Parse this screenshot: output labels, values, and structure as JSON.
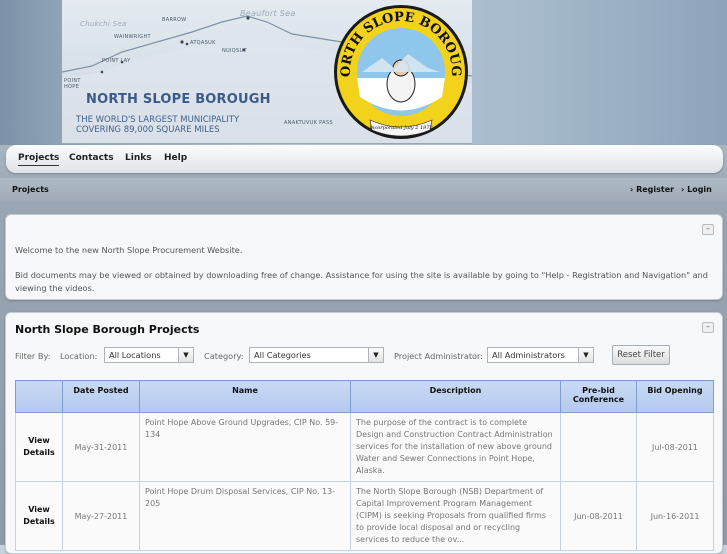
{
  "header": {
    "brand_title": "NORTH SLOPE BOROUGH",
    "brand_tagline_1": "THE WORLD'S LARGEST MUNICIPALITY",
    "brand_tagline_2": "COVERING 89,000 SQUARE MILES",
    "map_labels": [
      "BARROW",
      "WAINWRIGHT",
      "ATQASUK",
      "NUIQSUT",
      "POINT LAY",
      "POINT HOPE",
      "ANAKTUVUK PASS",
      "Beaufort Sea",
      "Chukchi Sea"
    ],
    "seal": {
      "ring_text": "NORTH SLOPE BOROUGH",
      "banner_text": "Incorporated July 2 1972",
      "logo_color": "#f2d21a",
      "ring_color": "#1a1a1a",
      "sky_color": "#8fc6ec"
    }
  },
  "nav": {
    "items": [
      "Projects",
      "Contacts",
      "Links",
      "Help"
    ],
    "active": "Projects"
  },
  "breadcrumb": {
    "current": "Projects",
    "register": "Register",
    "login": "Login"
  },
  "welcome": {
    "line1": "Welcome to the new North Slope Procurement Website.",
    "line2": "Bid documents may be viewed or obtained by downloading free of change. Assistance for using the site is available by going to \"Help - Registration and Navigation\" and viewing the videos."
  },
  "projects": {
    "title": "North Slope Borough Projects",
    "filter_by": "Filter By:",
    "location_label": "Location:",
    "location_value": "All Locations",
    "category_label": "Category:",
    "category_value": "All Categories",
    "admin_label": "Project Administrator:",
    "admin_value": "All Administrators",
    "reset_label": "Reset Filter",
    "columns": [
      "",
      "Date Posted",
      "Name",
      "Description",
      "Pre-bid Conference",
      "Bid Opening"
    ],
    "rows": [
      {
        "view": "View Details",
        "date_posted": "May-31-2011",
        "name": "Point Hope Above Ground Upgrades, CIP No. 59-134",
        "description": "The purpose of the contract is to complete Design and Construction Contract Administration services for the installation of new above ground Water and Sewer Connections in Point Hope, Alaska.",
        "prebid": "",
        "bid_opening": "Jul-08-2011"
      },
      {
        "view": "View Details",
        "date_posted": "May-27-2011",
        "name": "Point Hope Drum Disposal Services, CIP No. 13-205",
        "description": "The North Slope Borough (NSB) Department of Capital Improvement Program Management (CIPM) is seeking Proposals from qualified firms to provide local disposal and or recycling services to reduce the ov...",
        "prebid": "Jun-08-2011",
        "bid_opening": "Jun-16-2011"
      }
    ]
  },
  "colors": {
    "table_header": "#b9cdf0",
    "table_header_border": "#7f9ecd",
    "brand_text": "#3b5a8a"
  }
}
